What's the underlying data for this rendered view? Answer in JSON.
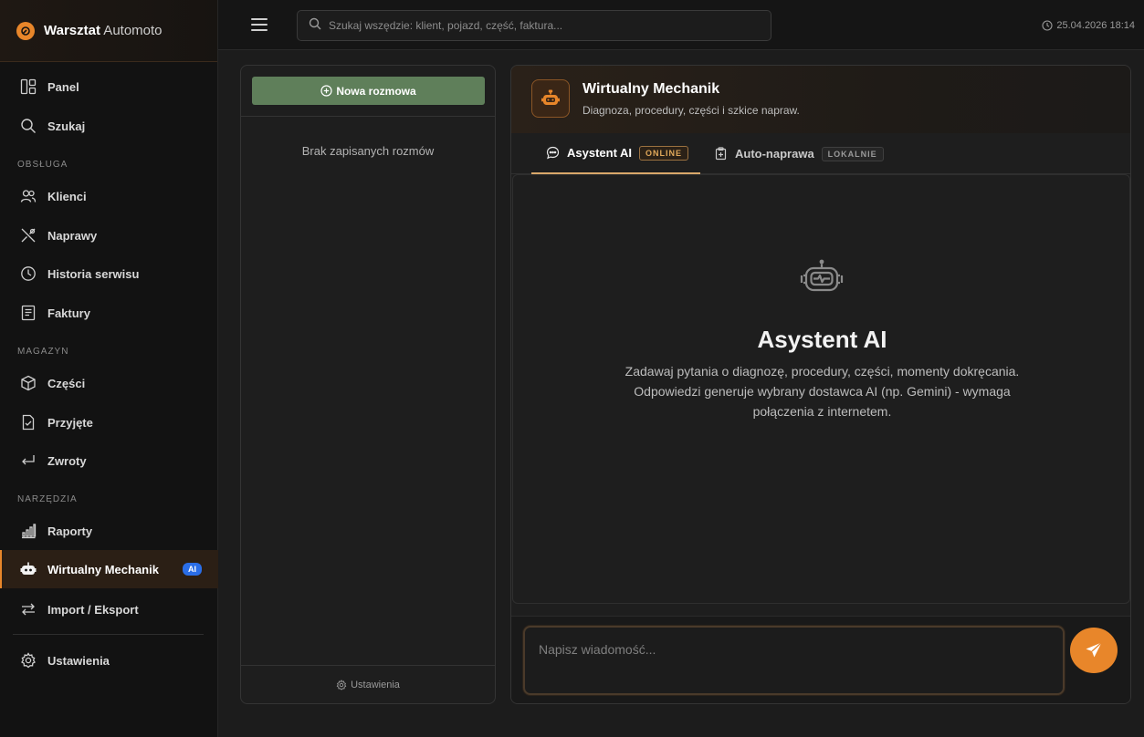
{
  "app": {
    "brand_bold": "Warsztat",
    "brand_rest": " Automoto",
    "accent_color": "#e8862a"
  },
  "sidebar": {
    "items": [
      {
        "label": "Panel",
        "icon": "dashboard-icon"
      },
      {
        "label": "Szukaj",
        "icon": "search-icon"
      },
      {
        "label": "Klienci",
        "icon": "users-icon"
      },
      {
        "label": "Naprawy",
        "icon": "tools-icon"
      },
      {
        "label": "Historia serwisu",
        "icon": "history-icon"
      },
      {
        "label": "Faktury",
        "icon": "invoice-icon"
      },
      {
        "label": "Części",
        "icon": "box-icon"
      },
      {
        "label": "Przyjęte",
        "icon": "clipboard-check-icon"
      },
      {
        "label": "Zwroty",
        "icon": "return-icon"
      },
      {
        "label": "Raporty",
        "icon": "chart-icon"
      },
      {
        "label": "Wirtualny Mechanik",
        "icon": "robot-icon",
        "badge": "AI",
        "active": true
      },
      {
        "label": "Import / Eksport",
        "icon": "swap-icon"
      },
      {
        "label": "Ustawienia",
        "icon": "gear-icon"
      }
    ],
    "sections": {
      "service": "OBSŁUGA",
      "warehouse": "MAGAZYN",
      "tools": "NARZĘDZIA"
    }
  },
  "topbar": {
    "search_placeholder": "Szukaj wszędzie: klient, pojazd, część, faktura...",
    "datetime": "25.04.2026 18:14"
  },
  "conversations": {
    "new_button": "Nowa rozmowa",
    "empty_text": "Brak zapisanych rozmów",
    "settings_label": "Ustawienia"
  },
  "chat": {
    "title": "Wirtualny Mechanik",
    "subtitle": "Diagnoza, procedury, części i szkice napraw.",
    "tabs": [
      {
        "label": "Asystent AI",
        "badge": "ONLINE",
        "active": true
      },
      {
        "label": "Auto-naprawa",
        "badge": "LOKALNIE",
        "active": false
      }
    ],
    "empty_title": "Asystent AI",
    "empty_desc": "Zadawaj pytania o diagnozę, procedury, części, momenty dokręcania. Odpowiedzi generuje wybrany dostawca AI (np. Gemini) - wymaga połączenia z internetem.",
    "input_placeholder": "Napisz wiadomość..."
  }
}
